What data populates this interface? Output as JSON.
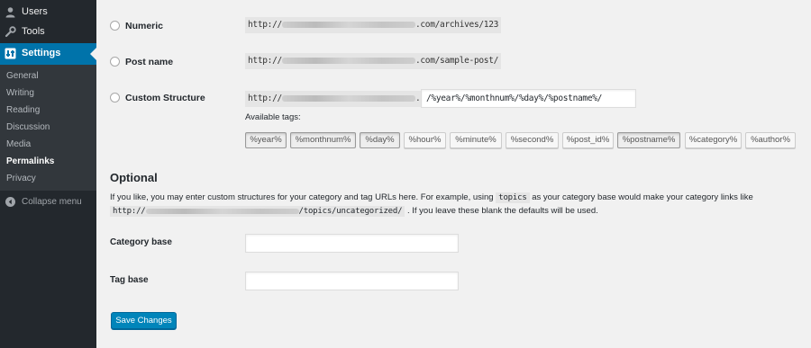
{
  "sidebar": {
    "menu": [
      {
        "label": "Users",
        "icon": "users-icon"
      },
      {
        "label": "Tools",
        "icon": "wrench-icon"
      },
      {
        "label": "Settings",
        "icon": "settings-icon"
      }
    ],
    "submenu": [
      "General",
      "Writing",
      "Reading",
      "Discussion",
      "Media",
      "Permalinks",
      "Privacy"
    ],
    "current_submenu": "Permalinks",
    "collapse_label": "Collapse menu"
  },
  "permalinks": {
    "options": [
      {
        "label": "Numeric",
        "example_prefix": "http://",
        "example_suffix": ".com/archives/123"
      },
      {
        "label": "Post name",
        "example_prefix": "http://",
        "example_suffix": ".com/sample-post/"
      },
      {
        "label": "Custom Structure",
        "example_prefix": "http://",
        "example_suffix": ".com",
        "value": "/%year%/%monthnum%/%day%/%postname%/"
      }
    ],
    "available_tags_label": "Available tags:",
    "tags": [
      "%year%",
      "%monthnum%",
      "%day%",
      "%hour%",
      "%minute%",
      "%second%",
      "%post_id%",
      "%postname%",
      "%category%",
      "%author%"
    ],
    "active_tags": [
      "%year%",
      "%monthnum%",
      "%day%",
      "%postname%"
    ]
  },
  "optional": {
    "heading": "Optional",
    "desc_part1": "If you like, you may enter custom structures for your category and tag URLs here. For example, using",
    "desc_code1": "topics",
    "desc_part2": "as your category base would make your category links like",
    "desc_code2_prefix": "http://",
    "desc_code2_suffix": "/topics/uncategorized/",
    "desc_part3": ". If you leave these blank the defaults will be used.",
    "category_base_label": "Category base",
    "category_base_value": "",
    "tag_base_label": "Tag base",
    "tag_base_value": ""
  },
  "save_button": "Save Changes",
  "colors": {
    "sidebar_bg": "#23282d",
    "submenu_bg": "#32373c",
    "accent": "#0073aa",
    "button": "#0085ba"
  }
}
